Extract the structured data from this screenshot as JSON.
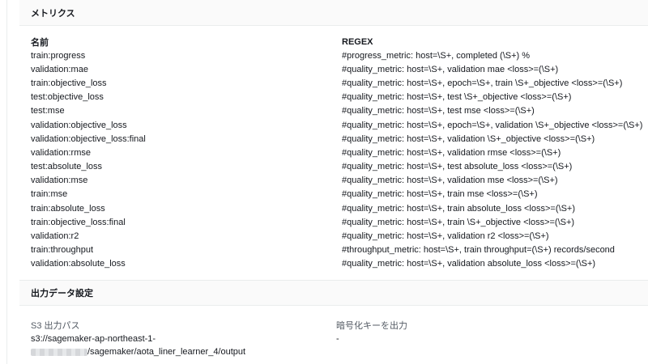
{
  "metrics": {
    "title": "メトリクス",
    "columns": {
      "name": "名前",
      "regex": "REGEX"
    },
    "rows": [
      {
        "name": "train:progress",
        "regex": "#progress_metric: host=\\S+, completed (\\S+) %"
      },
      {
        "name": "validation:mae",
        "regex": "#quality_metric: host=\\S+, validation mae <loss>=(\\S+)"
      },
      {
        "name": "train:objective_loss",
        "regex": "#quality_metric: host=\\S+, epoch=\\S+, train \\S+_objective <loss>=(\\S+)"
      },
      {
        "name": "test:objective_loss",
        "regex": "#quality_metric: host=\\S+, test \\S+_objective <loss>=(\\S+)"
      },
      {
        "name": "test:mse",
        "regex": "#quality_metric: host=\\S+, test mse <loss>=(\\S+)"
      },
      {
        "name": "validation:objective_loss",
        "regex": "#quality_metric: host=\\S+, epoch=\\S+, validation \\S+_objective <loss>=(\\S+)"
      },
      {
        "name": "validation:objective_loss:final",
        "regex": "#quality_metric: host=\\S+, validation \\S+_objective <loss>=(\\S+)"
      },
      {
        "name": "validation:rmse",
        "regex": "#quality_metric: host=\\S+, validation rmse <loss>=(\\S+)"
      },
      {
        "name": "test:absolute_loss",
        "regex": "#quality_metric: host=\\S+, test absolute_loss <loss>=(\\S+)"
      },
      {
        "name": "validation:mse",
        "regex": "#quality_metric: host=\\S+, validation mse <loss>=(\\S+)"
      },
      {
        "name": "train:mse",
        "regex": "#quality_metric: host=\\S+, train mse <loss>=(\\S+)"
      },
      {
        "name": "train:absolute_loss",
        "regex": "#quality_metric: host=\\S+, train absolute_loss <loss>=(\\S+)"
      },
      {
        "name": "train:objective_loss:final",
        "regex": "#quality_metric: host=\\S+, train \\S+_objective <loss>=(\\S+)"
      },
      {
        "name": "validation:r2",
        "regex": "#quality_metric: host=\\S+, validation r2 <loss>=(\\S+)"
      },
      {
        "name": "train:throughput",
        "regex": "#throughput_metric: host=\\S+, train throughput=(\\S+) records/second"
      },
      {
        "name": "validation:absolute_loss",
        "regex": "#quality_metric: host=\\S+, validation absolute_loss <loss>=(\\S+)"
      }
    ]
  },
  "output": {
    "title": "出力データ設定",
    "s3_path_label": "S3 出力パス",
    "s3_path_line1": "s3://sagemaker-ap-northeast-1-",
    "s3_path_line2": "/sagemaker/aota_liner_learner_4/output",
    "encryption_label": "暗号化キーを出力",
    "encryption_value": "-"
  }
}
